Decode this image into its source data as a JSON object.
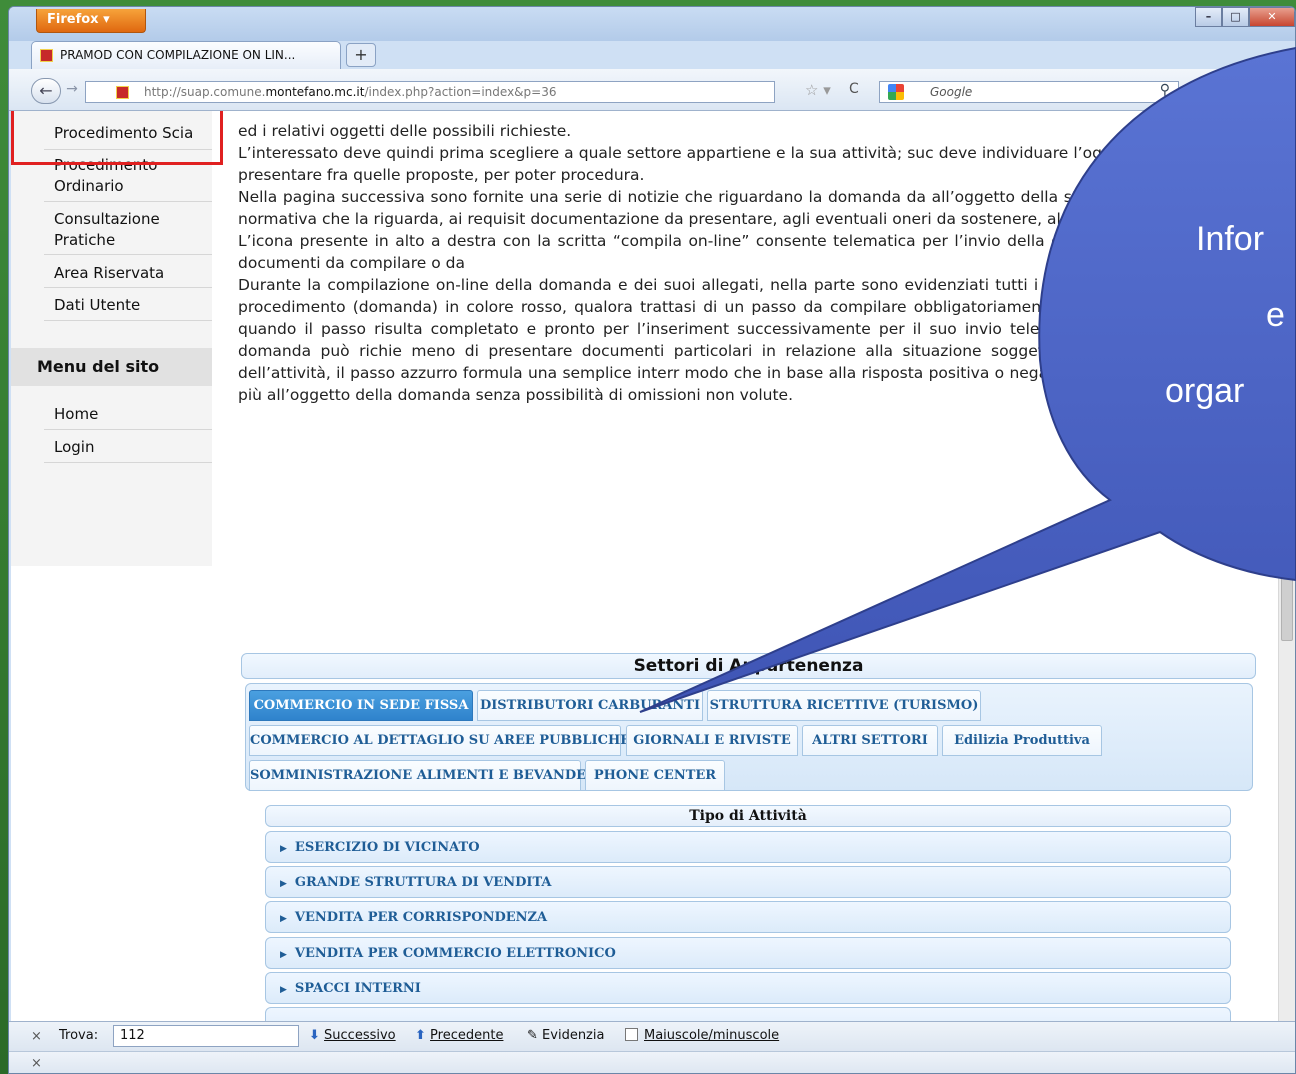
{
  "browser": {
    "app_button": "Firefox ▾",
    "tab_title": "PRAMOD CON COMPILAZIONE ON LIN...",
    "new_tab": "+",
    "url_prefix": "http://suap.comune.",
    "url_domain": "montefano.mc.it",
    "url_suffix": "/index.php?action=index&p=36",
    "search_placeholder": "Google"
  },
  "sidebar": {
    "items": [
      {
        "label": "Procedimento Scia"
      },
      {
        "label": "Procedimento Ordinario"
      },
      {
        "label": "Consultazione Pratiche"
      },
      {
        "label": "Area Riservata"
      },
      {
        "label": "Dati Utente"
      }
    ],
    "menu_heading": "Menu del sito",
    "menu_items": [
      {
        "label": "Home"
      },
      {
        "label": "Login"
      }
    ]
  },
  "article": {
    "paragraphs": [
      "ed i relativi oggetti delle possibili richieste.",
      "     L’interessato deve quindi prima scegliere a quale settore appartiene e la sua attività; suc deve individuare l’oggetto della domanda da presentare fra quelle proposte, per poter procedura.",
      "   Nella pagina successiva sono fornite una serie di notizie che riguardano la domanda da all’oggetto della stessa (inquadramento), alla normativa che la riguarda, ai requisit documentazione da presentare, agli eventuali oneri da sostenere, al responsabile del p",
      "          L’icona presente in alto a destra con la scritta “compila on-line” consente telematica per l’invio della domanda, che presenta tutti i documenti da compilare o da",
      "      Durante la compilazione on-line della domanda e dei suoi allegati, nella parte sono evidenziati tutti i passi in cui si articola l’iter del procedimento (domanda) in colore rosso, qualora trattasi di un passo da compilare obbligatoriamente; giallo, s facoltativo e verde quando il passo risulta completato e pronto per l’inseriment successivamente per il suo invio telematico. Considerato poi che la domanda può richie meno di presentare documenti particolari in relazione alla situazione soggettiva dell relazione alla natura dell’attività, il passo azzurro formula una semplice interr modo che in base alla risposta positiva o negativa ottenuta, i successivi pass più all’oggetto della domanda senza possibilità di omissioni non volute."
    ]
  },
  "settori": {
    "title": "Settori di Appartenenza",
    "tabs": [
      {
        "label": "COMMERCIO IN SEDE FISSA",
        "active": true
      },
      {
        "label": "DISTRIBUTORI CARBURANTI"
      },
      {
        "label": "STRUTTURA RICETTIVE (TURISMO)"
      },
      {
        "label": "COMMERCIO AL DETTAGLIO SU AREE PUBBLICHE"
      },
      {
        "label": "GIORNALI E RIVISTE"
      },
      {
        "label": "ALTRI SETTORI"
      },
      {
        "label": "Edilizia Produttiva"
      },
      {
        "label": "SOMMINISTRAZIONE ALIMENTI E BEVANDE"
      },
      {
        "label": "PHONE CENTER"
      }
    ]
  },
  "tipo": {
    "title": "Tipo di Attività",
    "items": [
      {
        "label": "ESERCIZIO DI VICINATO"
      },
      {
        "label": "GRANDE STRUTTURA DI VENDITA"
      },
      {
        "label": "VENDITA PER CORRISPONDENZA"
      },
      {
        "label": "VENDITA PER COMMERCIO ELETTRONICO"
      },
      {
        "label": "SPACCI INTERNI"
      }
    ]
  },
  "findbar": {
    "close": "×",
    "label": "Trova:",
    "value": "112",
    "next": "Successivo",
    "prev": "Precedente",
    "highlight": "Evidenzia",
    "match_case": "Maiuscole/minuscole"
  },
  "statusbar": {
    "close": "×"
  },
  "callout": {
    "line1": "Infor",
    "line2": "e",
    "line3": "orgar"
  },
  "colors": {
    "callout_fill": "#4a63c4",
    "highlight_border": "#e02020",
    "active_tab": "#2f83cc"
  }
}
